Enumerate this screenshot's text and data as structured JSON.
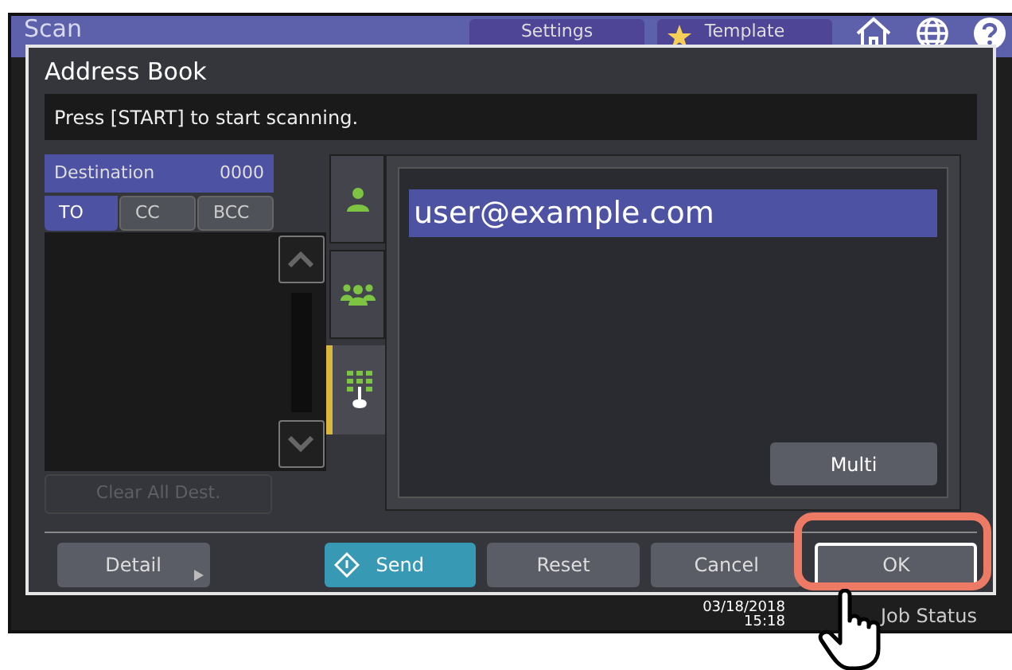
{
  "screen": {
    "title": "Scan",
    "header_tabs": [
      {
        "label": "Settings",
        "kind": "plain"
      },
      {
        "label": "Template",
        "kind": "star"
      }
    ]
  },
  "dialog": {
    "title": "Address Book",
    "message": "Press [START] to start scanning.",
    "destination": {
      "label": "Destination",
      "count": "0000"
    },
    "recipient_tabs": [
      {
        "label": "TO",
        "selected": true
      },
      {
        "label": "CC",
        "selected": false
      },
      {
        "label": "BCC",
        "selected": false
      }
    ],
    "side_tabs": [
      {
        "kind": "person",
        "selected": false
      },
      {
        "kind": "group",
        "selected": false
      },
      {
        "kind": "keypad",
        "selected": true
      }
    ],
    "address_field": {
      "value": "user@example.com"
    },
    "multi_button": "Multi",
    "clear_button": {
      "label": "Clear All Dest.",
      "disabled": true
    },
    "footer_buttons": [
      {
        "label": "Detail",
        "kind": "more"
      },
      {
        "label": "Send",
        "kind": "send"
      },
      {
        "label": "Reset",
        "kind": "plain"
      },
      {
        "label": "Cancel",
        "kind": "plain"
      },
      {
        "label": "OK",
        "kind": "ok"
      }
    ]
  },
  "status_bar": {
    "date": "03/18/2018",
    "time": "15:18",
    "job_status": "Job Status"
  }
}
